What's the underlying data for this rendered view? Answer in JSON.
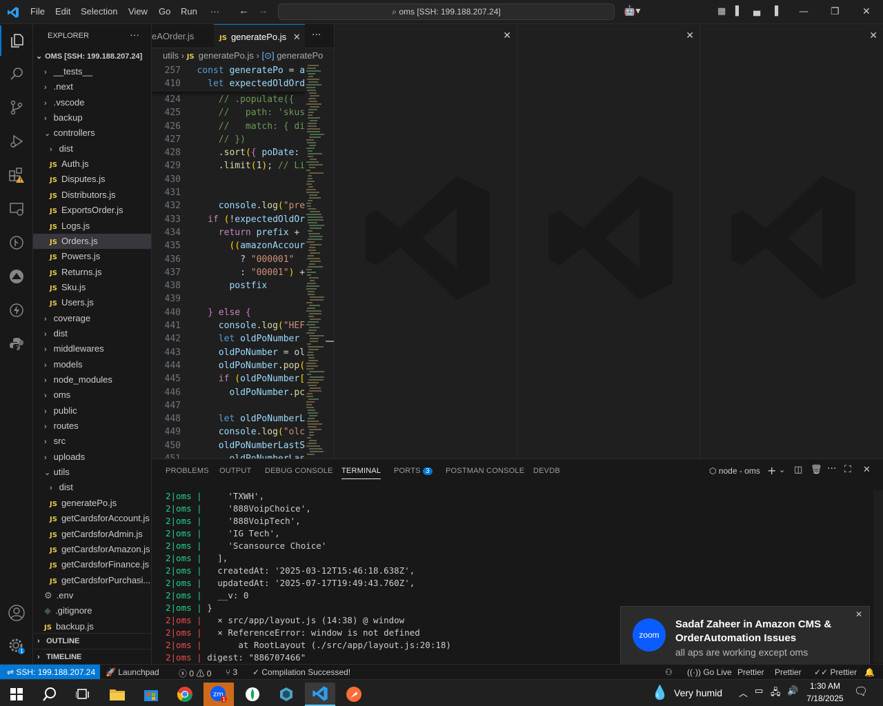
{
  "titlebar": {
    "menus": [
      "File",
      "Edit",
      "Selection",
      "View",
      "Go",
      "Run",
      "···"
    ],
    "command_center": "oms [SSH: 199.188.207.24]"
  },
  "explorer": {
    "header": "EXPLORER",
    "root": "OMS [SSH: 199.188.207.24]",
    "items": [
      {
        "label": "__tests__",
        "type": "folder",
        "indent": 1,
        "open": false
      },
      {
        "label": ".next",
        "type": "folder",
        "indent": 1,
        "open": false
      },
      {
        "label": ".vscode",
        "type": "folder",
        "indent": 1,
        "open": false
      },
      {
        "label": "backup",
        "type": "folder",
        "indent": 1,
        "open": false
      },
      {
        "label": "controllers",
        "type": "folder",
        "indent": 1,
        "open": true
      },
      {
        "label": "dist",
        "type": "folder",
        "indent": 2,
        "open": false
      },
      {
        "label": "Auth.js",
        "type": "js",
        "indent": 2
      },
      {
        "label": "Disputes.js",
        "type": "js",
        "indent": 2
      },
      {
        "label": "Distributors.js",
        "type": "js",
        "indent": 2
      },
      {
        "label": "ExportsOrder.js",
        "type": "js",
        "indent": 2
      },
      {
        "label": "Logs.js",
        "type": "js",
        "indent": 2
      },
      {
        "label": "Orders.js",
        "type": "js",
        "indent": 2,
        "selected": true
      },
      {
        "label": "Powers.js",
        "type": "js",
        "indent": 2
      },
      {
        "label": "Returns.js",
        "type": "js",
        "indent": 2
      },
      {
        "label": "Sku.js",
        "type": "js",
        "indent": 2
      },
      {
        "label": "Users.js",
        "type": "js",
        "indent": 2
      },
      {
        "label": "coverage",
        "type": "folder",
        "indent": 1,
        "open": false
      },
      {
        "label": "dist",
        "type": "folder",
        "indent": 1,
        "open": false
      },
      {
        "label": "middlewares",
        "type": "folder",
        "indent": 1,
        "open": false
      },
      {
        "label": "models",
        "type": "folder",
        "indent": 1,
        "open": false
      },
      {
        "label": "node_modules",
        "type": "folder",
        "indent": 1,
        "open": false
      },
      {
        "label": "oms",
        "type": "folder",
        "indent": 1,
        "open": false
      },
      {
        "label": "public",
        "type": "folder",
        "indent": 1,
        "open": false
      },
      {
        "label": "routes",
        "type": "folder",
        "indent": 1,
        "open": false
      },
      {
        "label": "src",
        "type": "folder",
        "indent": 1,
        "open": false
      },
      {
        "label": "uploads",
        "type": "folder",
        "indent": 1,
        "open": false
      },
      {
        "label": "utils",
        "type": "folder",
        "indent": 1,
        "open": true
      },
      {
        "label": "dist",
        "type": "folder",
        "indent": 2,
        "open": false
      },
      {
        "label": "generatePo.js",
        "type": "js",
        "indent": 2
      },
      {
        "label": "getCardsforAccount.js",
        "type": "js",
        "indent": 2
      },
      {
        "label": "getCardsforAdmin.js",
        "type": "js",
        "indent": 2
      },
      {
        "label": "getCardsforAmazon.js",
        "type": "js",
        "indent": 2
      },
      {
        "label": "getCardsforFinance.js",
        "type": "js",
        "indent": 2
      },
      {
        "label": "getCardsforPurchasi...",
        "type": "js",
        "indent": 2
      },
      {
        "label": ".env",
        "type": "env",
        "indent": 1
      },
      {
        "label": ".gitignore",
        "type": "git",
        "indent": 1
      },
      {
        "label": "backup.js",
        "type": "js",
        "indent": 1
      }
    ],
    "outline": "OUTLINE",
    "timeline": "TIMELINE"
  },
  "editor": {
    "tabs": [
      {
        "label": "eAOrder.js",
        "active": false
      },
      {
        "label": "generatePo.js",
        "active": true
      }
    ],
    "breadcrumb": [
      "utils",
      "generatePo.js",
      "generatePo"
    ],
    "sticky": [
      {
        "ln": "257",
        "text": "const generatePo = a"
      },
      {
        "ln": "410",
        "text": "  let expectedOldOrd"
      }
    ],
    "lines": [
      {
        "ln": "424",
        "text": "    // .populate({"
      },
      {
        "ln": "425",
        "text": "    //   path: 'skus"
      },
      {
        "ln": "426",
        "text": "    //   match: { di"
      },
      {
        "ln": "427",
        "text": "    // })"
      },
      {
        "ln": "428",
        "text": "    .sort({ poDate: "
      },
      {
        "ln": "429",
        "text": "    .limit(1); // Li"
      },
      {
        "ln": "430",
        "text": ""
      },
      {
        "ln": "431",
        "text": ""
      },
      {
        "ln": "432",
        "text": "    console.log(\"pre"
      },
      {
        "ln": "433",
        "text": "  if (!expectedOldOr"
      },
      {
        "ln": "434",
        "text": "    return prefix + "
      },
      {
        "ln": "435",
        "text": "      ((amazonAccour"
      },
      {
        "ln": "436",
        "text": "        ? \"000001\""
      },
      {
        "ln": "437",
        "text": "        : \"00001\") +"
      },
      {
        "ln": "438",
        "text": "      postfix"
      },
      {
        "ln": "439",
        "text": ""
      },
      {
        "ln": "440",
        "text": "  } else {"
      },
      {
        "ln": "441",
        "text": "    console.log(\"HEF"
      },
      {
        "ln": "442",
        "text": "    let oldPoNumber "
      },
      {
        "ln": "443",
        "text": "    oldPoNumber = ol"
      },
      {
        "ln": "444",
        "text": "    oldPoNumber.pop("
      },
      {
        "ln": "445",
        "text": "    if (oldPoNumber["
      },
      {
        "ln": "446",
        "text": "      oldPoNumber.pc"
      },
      {
        "ln": "447",
        "text": ""
      },
      {
        "ln": "448",
        "text": "    let oldPoNumberL"
      },
      {
        "ln": "449",
        "text": "    console.log(\"olc"
      },
      {
        "ln": "450",
        "text": "    oldPoNumberLastS"
      },
      {
        "ln": "451",
        "text": "      oldPoNumberLas"
      }
    ]
  },
  "panel": {
    "tabs": [
      "PROBLEMS",
      "OUTPUT",
      "DEBUG CONSOLE",
      "TERMINAL",
      "PORTS",
      "POSTMAN CONSOLE",
      "DEVDB"
    ],
    "active_tab": "TERMINAL",
    "ports_badge": "3",
    "terminal_name": "node - oms",
    "terminal_lines": [
      {
        "prefix": "2|oms",
        "bar": "|",
        "text": "    'TXWH',",
        "err": false
      },
      {
        "prefix": "2|oms",
        "bar": "|",
        "text": "    '888VoipChoice',",
        "err": false
      },
      {
        "prefix": "2|oms",
        "bar": "|",
        "text": "    '888VoipTech',",
        "err": false
      },
      {
        "prefix": "2|oms",
        "bar": "|",
        "text": "    'IG Tech',",
        "err": false
      },
      {
        "prefix": "2|oms",
        "bar": "|",
        "text": "    'Scansource Choice'",
        "err": false
      },
      {
        "prefix": "2|oms",
        "bar": "|",
        "text": "  ],",
        "err": false
      },
      {
        "prefix": "2|oms",
        "bar": "|",
        "text": "  createdAt: '2025-03-12T15:46:18.638Z',",
        "err": false
      },
      {
        "prefix": "2|oms",
        "bar": "|",
        "text": "  updatedAt: '2025-07-17T19:49:43.760Z',",
        "err": false
      },
      {
        "prefix": "2|oms",
        "bar": "|",
        "text": "  __v: 0",
        "err": false
      },
      {
        "prefix": "2|oms",
        "bar": "|",
        "text": "}",
        "err": false
      },
      {
        "prefix": "2|oms",
        "bar": "|",
        "text": "  ⨯ src/app/layout.js (14:38) @ window",
        "err": true
      },
      {
        "prefix": "2|oms",
        "bar": "|",
        "text": "  ⨯ ReferenceError: window is not defined",
        "err": true
      },
      {
        "prefix": "2|oms",
        "bar": "|",
        "text": "      at RootLayout (./src/app/layout.js:20:18)",
        "err": true
      },
      {
        "prefix": "2|oms",
        "bar": "|",
        "text": "digest: \"886707466\"",
        "err": true
      }
    ]
  },
  "notification": {
    "app": "zoom",
    "title": "Sadaf Zaheer in Amazon CMS & OrderAutomation Issues",
    "body": "all aps are working except oms"
  },
  "statusbar": {
    "remote": "SSH: 199.188.207.24",
    "launchpad": "Launchpad",
    "errors": "0",
    "warnings": "0",
    "ports": "3",
    "compile": "Compilation Successed!",
    "golive": "Go Live",
    "prettier1": "Prettier",
    "prettier2": "Prettier",
    "prettier3": "Prettier"
  },
  "taskbar": {
    "weather": "Very humid",
    "time": "1:30 AM",
    "date": "7/18/2025",
    "zoom_badge": "1"
  },
  "colors": {
    "accent": "#0078d4",
    "js": "#e8c94a",
    "error": "#f14c4c",
    "ok": "#23d18b"
  }
}
